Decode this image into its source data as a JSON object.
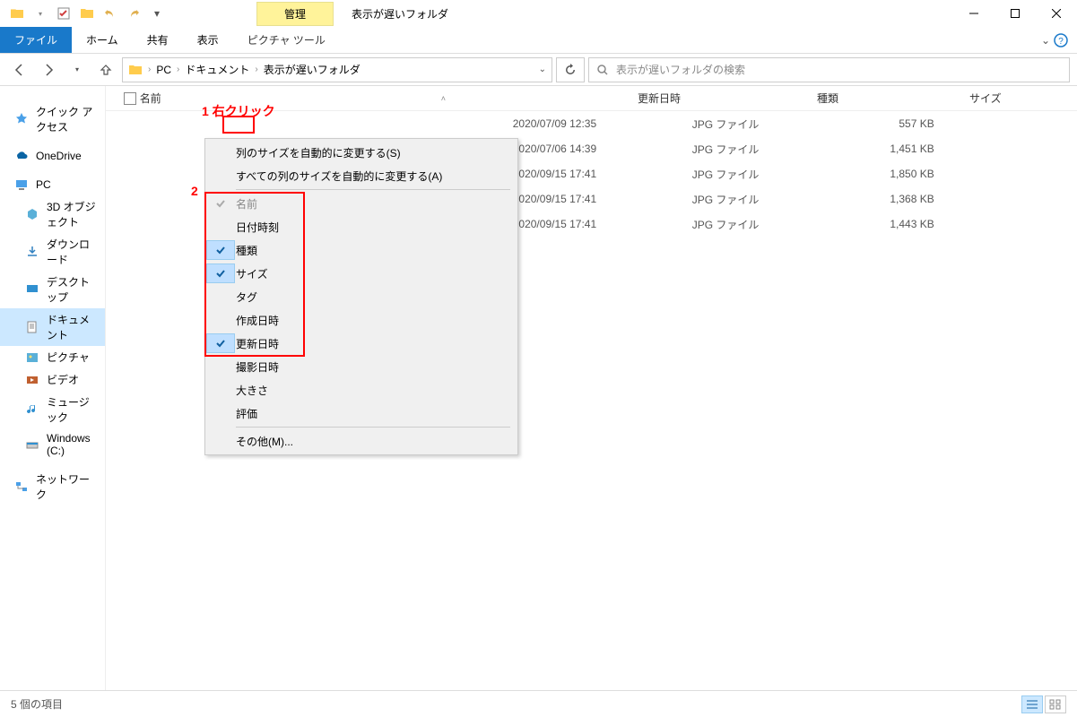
{
  "title": "表示が遅いフォルダ",
  "manage_tab": "管理",
  "ribbon": {
    "file": "ファイル",
    "home": "ホーム",
    "share": "共有",
    "view": "表示",
    "pictools": "ピクチャ ツール"
  },
  "breadcrumb": [
    "PC",
    "ドキュメント",
    "表示が遅いフォルダ"
  ],
  "search_placeholder": "表示が遅いフォルダの検索",
  "annotations": {
    "a1": "1 右クリック",
    "a2": "2"
  },
  "sidebar": {
    "quick": "クイック アクセス",
    "onedrive": "OneDrive",
    "pc": "PC",
    "objects3d": "3D オブジェクト",
    "downloads": "ダウンロード",
    "desktop": "デスクトップ",
    "documents": "ドキュメント",
    "pictures": "ピクチャ",
    "videos": "ビデオ",
    "music": "ミュージック",
    "cdrive": "Windows (C:)",
    "network": "ネットワーク"
  },
  "columns": {
    "name": "名前",
    "date": "更新日時",
    "type": "種類",
    "size": "サイズ"
  },
  "context_menu": {
    "fit_col": "列のサイズを自動的に変更する(S)",
    "fit_all": "すべての列のサイズを自動的に変更する(A)",
    "name": "名前",
    "datetime": "日付時刻",
    "type": "種類",
    "size": "サイズ",
    "tag": "タグ",
    "created": "作成日時",
    "modified": "更新日時",
    "taken": "撮影日時",
    "dimensions": "大きさ",
    "rating": "評価",
    "other": "その他(M)..."
  },
  "files": [
    {
      "date": "2020/07/09 12:35",
      "type": "JPG ファイル",
      "size": "557 KB"
    },
    {
      "date": "2020/07/06 14:39",
      "type": "JPG ファイル",
      "size": "1,451 KB"
    },
    {
      "date": "2020/09/15 17:41",
      "type": "JPG ファイル",
      "size": "1,850 KB"
    },
    {
      "date": "2020/09/15 17:41",
      "type": "JPG ファイル",
      "size": "1,368 KB"
    },
    {
      "date": "2020/09/15 17:41",
      "type": "JPG ファイル",
      "size": "1,443 KB"
    }
  ],
  "status": "5 個の項目"
}
